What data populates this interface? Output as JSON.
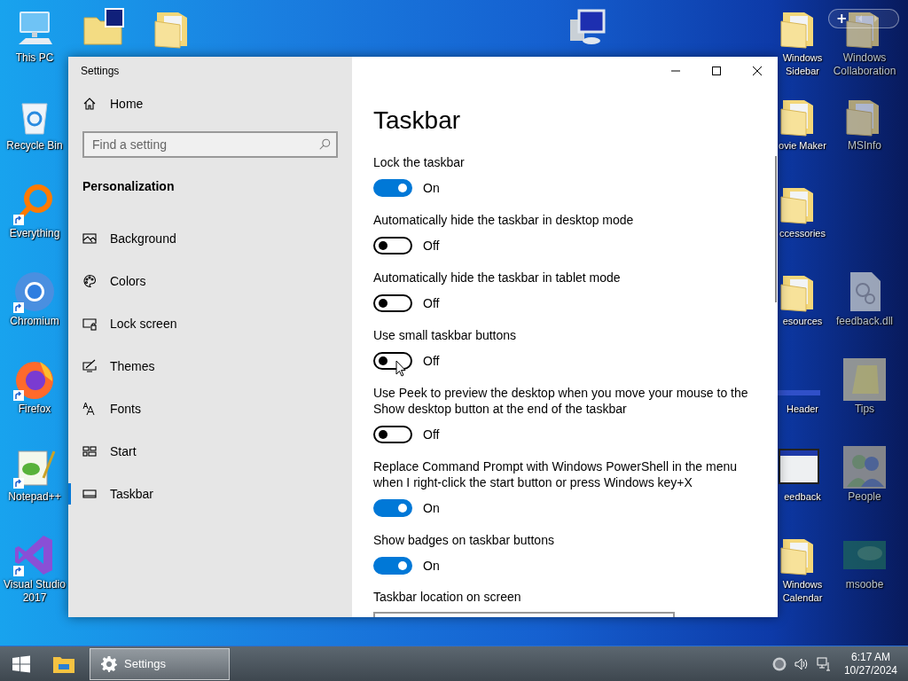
{
  "desktop_icons": [
    {
      "label": "This PC",
      "shortcut": false,
      "dimmed": false
    },
    {
      "shortcut": false,
      "dimmed": false
    },
    {
      "shortcut": false,
      "dimmed": false
    },
    {
      "shortcut": false,
      "dimmed": false
    },
    {
      "label": "Windows Sidebar",
      "shortcut": false,
      "dimmed": false
    },
    {
      "label": "Windows Collaboration",
      "shortcut": false,
      "dimmed": true
    },
    {
      "label": "Recycle Bin",
      "shortcut": false,
      "dimmed": false
    },
    {
      "label": "ovie Maker",
      "shortcut": false,
      "dimmed": false
    },
    {
      "label": "MSInfo",
      "shortcut": false,
      "dimmed": true
    },
    {
      "label": "Everything",
      "shortcut": true,
      "dimmed": false
    },
    {
      "label": "ccessories",
      "shortcut": false,
      "dimmed": false
    },
    {
      "label": "Chromium",
      "shortcut": true,
      "dimmed": false
    },
    {
      "label": "esources",
      "shortcut": false,
      "dimmed": false
    },
    {
      "label": "feedback.dll",
      "shortcut": false,
      "dimmed": true
    },
    {
      "label": "Firefox",
      "shortcut": true,
      "dimmed": false
    },
    {
      "label": "Header",
      "shortcut": false,
      "dimmed": false
    },
    {
      "label": "Tips",
      "shortcut": false,
      "dimmed": true
    },
    {
      "label": "Notepad++",
      "shortcut": true,
      "dimmed": false
    },
    {
      "label": "eedback",
      "shortcut": false,
      "dimmed": false
    },
    {
      "label": "People",
      "shortcut": false,
      "dimmed": true
    },
    {
      "label": "Visual Studio 2017",
      "shortcut": true,
      "dimmed": false
    },
    {
      "label": "Windows Calendar",
      "shortcut": false,
      "dimmed": false
    },
    {
      "label": "msoobe",
      "shortcut": false,
      "dimmed": true
    }
  ],
  "gadget": {
    "add": "+"
  },
  "window": {
    "title": "Settings",
    "home": "Home",
    "search": {
      "placeholder": "Find a setting"
    },
    "section": "Personalization",
    "nav": [
      {
        "label": "Background",
        "selected": false
      },
      {
        "label": "Colors",
        "selected": false
      },
      {
        "label": "Lock screen",
        "selected": false
      },
      {
        "label": "Themes",
        "selected": false
      },
      {
        "label": "Fonts",
        "selected": false
      },
      {
        "label": "Start",
        "selected": false
      },
      {
        "label": "Taskbar",
        "selected": true
      }
    ],
    "page_title": "Taskbar",
    "settings": [
      {
        "label": "Lock the taskbar",
        "on": true,
        "state": "On"
      },
      {
        "label": "Automatically hide the taskbar in desktop mode",
        "on": false,
        "state": "Off"
      },
      {
        "label": "Automatically hide the taskbar in tablet mode",
        "on": false,
        "state": "Off"
      },
      {
        "label": "Use small taskbar buttons",
        "on": false,
        "state": "Off"
      },
      {
        "label": "Use Peek to preview the desktop when you move your mouse to the Show desktop button at the end of the taskbar",
        "on": false,
        "state": "Off"
      },
      {
        "label": "Replace Command Prompt with Windows PowerShell in the menu when I right-click the start button or press Windows key+X",
        "on": true,
        "state": "On"
      },
      {
        "label": "Show badges on taskbar buttons",
        "on": true,
        "state": "On"
      }
    ],
    "next_setting": "Taskbar location on screen"
  },
  "taskbar": {
    "windows": [
      {
        "label": "Settings",
        "active": true
      }
    ],
    "time": "6:17 AM",
    "date": "10/27/2024"
  }
}
